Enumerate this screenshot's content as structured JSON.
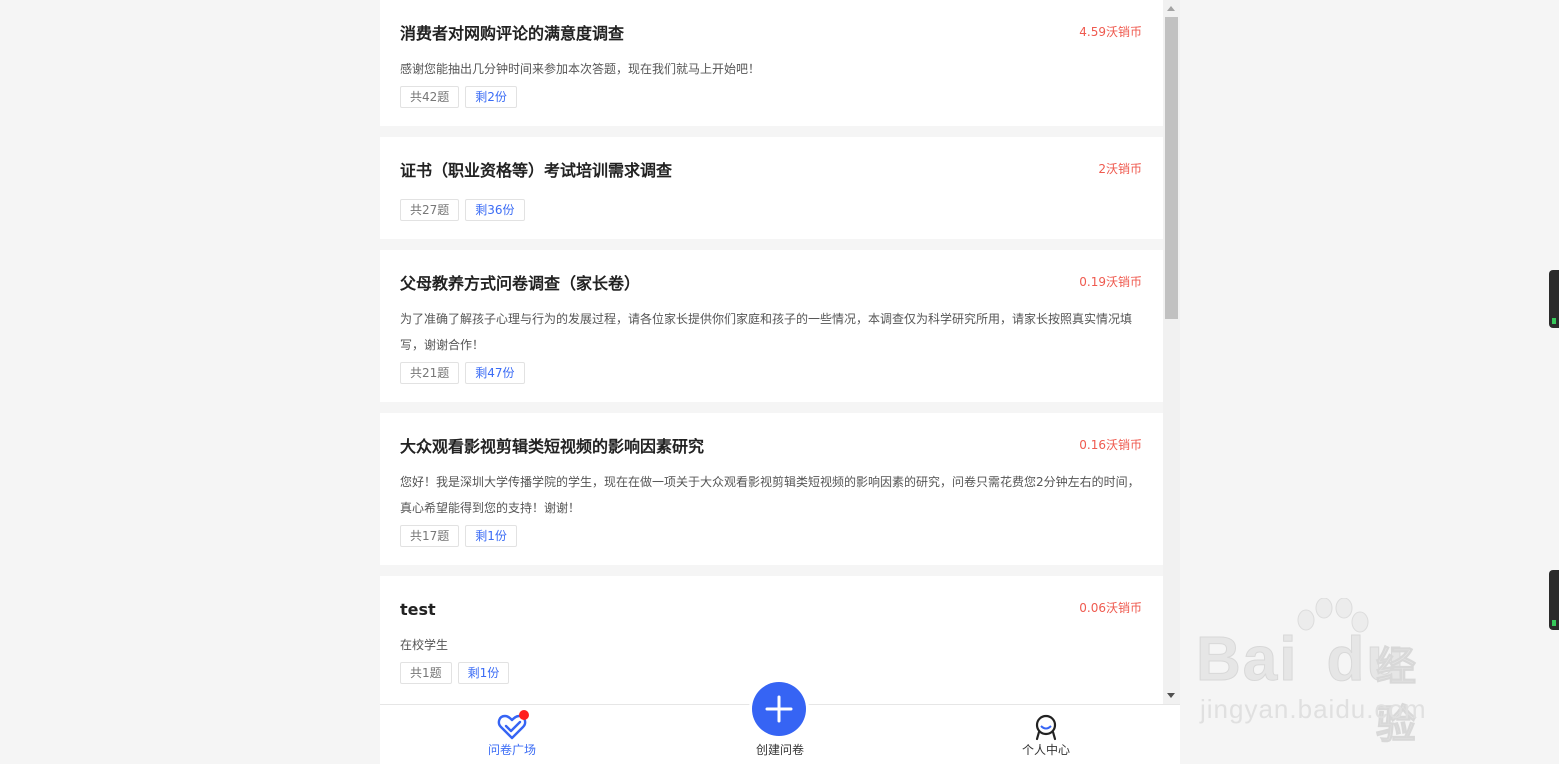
{
  "surveys": [
    {
      "title": "消费者对网购评论的满意度调查",
      "reward": "4.59沃销币",
      "desc": "感谢您能抽出几分钟时间来参加本次答题，现在我们就马上开始吧！",
      "questions": "共42题",
      "remaining": "剩2份"
    },
    {
      "title": "证书（职业资格等）考试培训需求调查",
      "reward": "2沃销币",
      "desc": "",
      "questions": "共27题",
      "remaining": "剩36份"
    },
    {
      "title": "父母教养方式问卷调查（家长卷）",
      "reward": "0.19沃销币",
      "desc": "为了准确了解孩子心理与行为的发展过程，请各位家长提供你们家庭和孩子的一些情况，本调查仅为科学研究所用，请家长按照真实情况填写，谢谢合作！",
      "questions": "共21题",
      "remaining": "剩47份"
    },
    {
      "title": "大众观看影视剪辑类短视频的影响因素研究",
      "reward": "0.16沃销币",
      "desc": "您好！我是深圳大学传播学院的学生，现在在做一项关于大众观看影视剪辑类短视频的影响因素的研究，问卷只需花费您2分钟左右的时间，真心希望能得到您的支持！谢谢！",
      "questions": "共17题",
      "remaining": "剩1份"
    },
    {
      "title": "test",
      "reward": "0.06沃销币",
      "desc": "在校学生",
      "questions": "共1题",
      "remaining": "剩1份"
    }
  ],
  "tabbar": {
    "home_label": "问卷广场",
    "create_label": "创建问卷",
    "me_label": "个人中心"
  },
  "watermark": {
    "brand": "Bai",
    "brand_tail": "du",
    "cn": "经验",
    "url": "jingyan.baidu.com"
  },
  "colors": {
    "accent": "#3664f4",
    "reward": "#ef5a4f",
    "tag_blue": "#3b6cf5"
  }
}
